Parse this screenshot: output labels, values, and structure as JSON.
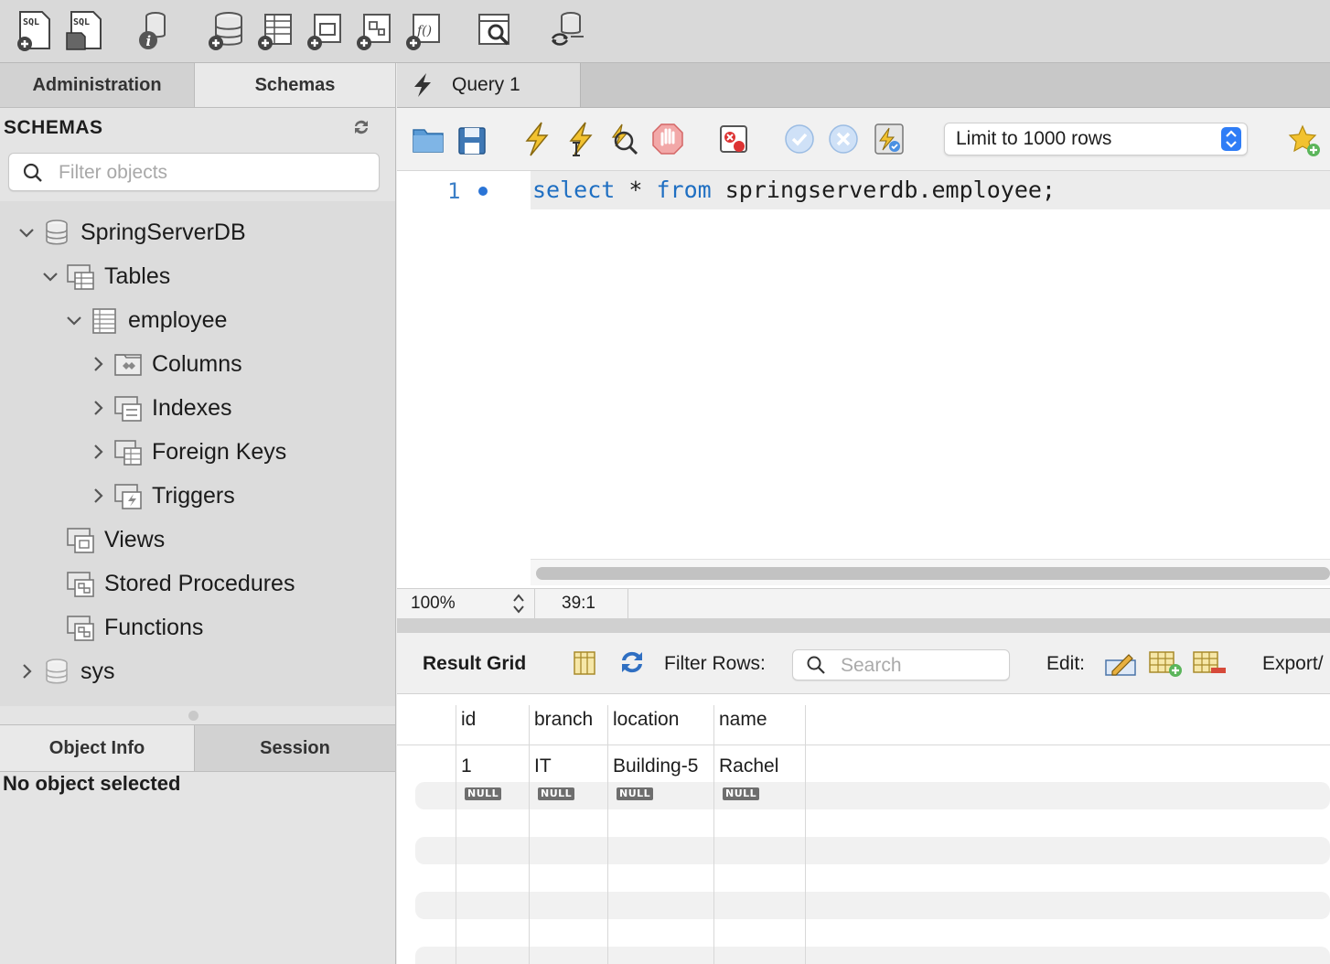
{
  "toolbar": {
    "icons": [
      "new-sql-tab-icon",
      "open-sql-script-icon",
      "schema-inspector-icon",
      "create-schema-icon",
      "create-table-icon",
      "create-view-icon",
      "create-procedure-icon",
      "create-function-icon",
      "search-table-data-icon",
      "reconnect-icon"
    ]
  },
  "left_tabs": {
    "administration": "Administration",
    "schemas": "Schemas"
  },
  "schemas": {
    "header": "SCHEMAS",
    "filter_placeholder": "Filter objects",
    "tree": [
      {
        "label": "SpringServerDB",
        "expanded": true
      },
      {
        "label": "Tables",
        "expanded": true
      },
      {
        "label": "employee",
        "expanded": true
      },
      {
        "label": "Columns",
        "expanded": false
      },
      {
        "label": "Indexes",
        "expanded": false
      },
      {
        "label": "Foreign Keys",
        "expanded": false
      },
      {
        "label": "Triggers",
        "expanded": false
      },
      {
        "label": "Views"
      },
      {
        "label": "Stored Procedures"
      },
      {
        "label": "Functions"
      },
      {
        "label": "sys",
        "expanded": false
      }
    ]
  },
  "info_tabs": {
    "object_info": "Object Info",
    "session": "Session"
  },
  "info_panel": {
    "message": "No object selected"
  },
  "query_tab": {
    "label": "Query 1"
  },
  "editor_toolbar": {
    "limit_value": "Limit to 1000 rows"
  },
  "editor": {
    "line_number": "1",
    "kw_select": "select",
    "star": " * ",
    "kw_from": "from",
    "rest": " springserverdb.employee;"
  },
  "status": {
    "zoom": "100%",
    "cursor": "39:1"
  },
  "result": {
    "label": "Result Grid",
    "filter_label": "Filter Rows:",
    "search_placeholder": "Search",
    "edit_label": "Edit:",
    "export_label": "Export/",
    "columns": [
      "id",
      "branch",
      "location",
      "name"
    ],
    "rows": [
      [
        "1",
        "IT",
        "Building-5",
        "Rachel"
      ]
    ],
    "null_label": "NULL"
  },
  "colors": {
    "keyword": "#1f6fc2",
    "accent": "#2f7df6"
  }
}
